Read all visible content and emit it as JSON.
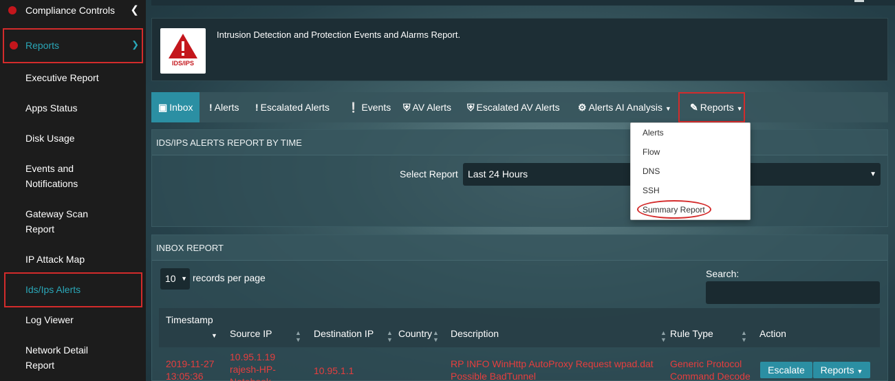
{
  "sidebar": {
    "compliance_label": "Compliance Controls",
    "reports_label": "Reports",
    "items": [
      {
        "label": "Executive Report"
      },
      {
        "label": "Apps Status"
      },
      {
        "label": "Disk Usage"
      },
      {
        "label": "Events and Notifications"
      },
      {
        "label": "Gateway Scan Report"
      },
      {
        "label": "IP Attack Map"
      },
      {
        "label": "Ids/Ips Alerts"
      },
      {
        "label": "Log Viewer"
      },
      {
        "label": "Network Detail Report"
      }
    ]
  },
  "info": {
    "badge_text": "IDS/IPS",
    "description": "Intrusion Detection and Protection Events and Alarms Report."
  },
  "tabs": [
    {
      "label": "Inbox",
      "icon": "inbox-icon"
    },
    {
      "label": "Alerts",
      "icon": "exclamation-icon"
    },
    {
      "label": "Escalated Alerts",
      "icon": "exclamation-icon"
    },
    {
      "label": "Events",
      "icon": "exclamation-circle-icon"
    },
    {
      "label": "AV Alerts",
      "icon": "shield-icon"
    },
    {
      "label": "Escalated AV Alerts",
      "icon": "shield-icon"
    },
    {
      "label": "Alerts AI Analysis",
      "icon": "gear-icon"
    },
    {
      "label": "Reports",
      "icon": "pencil-icon"
    }
  ],
  "reports_menu": [
    "Alerts",
    "Flow",
    "DNS",
    "SSH",
    "Summary Report"
  ],
  "alerts_panel": {
    "title": "IDS/IPS ALERTS REPORT BY TIME",
    "select_label": "Select Report",
    "select_value": "Last 24 Hours"
  },
  "inbox_panel": {
    "title": "INBOX REPORT",
    "records_value": "10",
    "records_label": "records per page",
    "search_label": "Search:",
    "columns": [
      "Timestamp",
      "Source IP",
      "Destination IP",
      "Country",
      "Description",
      "Rule Type",
      "Action"
    ],
    "rows": [
      {
        "timestamp_1": "2019-11-27",
        "timestamp_2": "13:05:36",
        "source_1": "10.95.1.19",
        "source_2": "rajesh-HP-",
        "source_3": "Notebook",
        "destination": "10.95.1.1",
        "country": "",
        "description_1": "RP INFO WinHttp AutoProxy Request wpad.dat",
        "description_2": "Possible BadTunnel",
        "rule_1": "Generic Protocol",
        "rule_2": "Command Decode",
        "escalate": "Escalate",
        "reports": "Reports"
      }
    ]
  }
}
